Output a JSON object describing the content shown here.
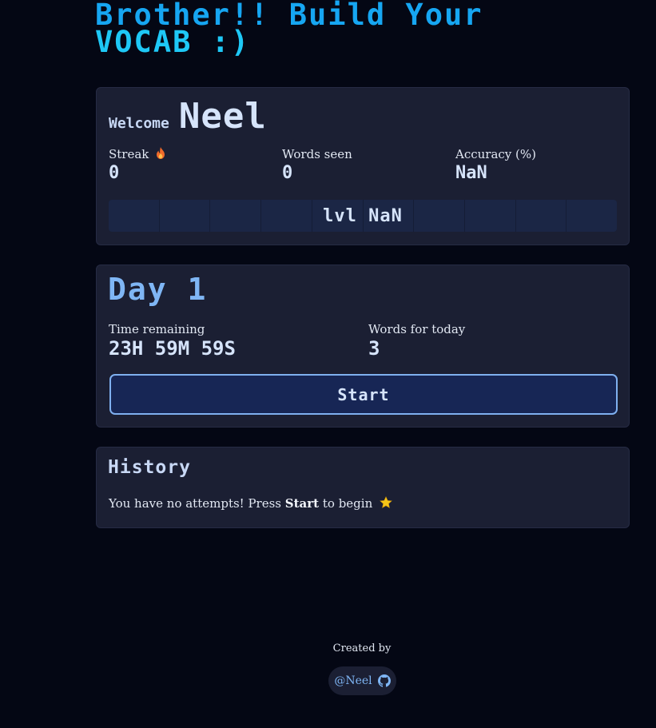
{
  "header": {
    "title_line1": "Brother!! Build Your",
    "title_line2": "VOCAB :)"
  },
  "welcome": {
    "label": "Welcome",
    "name": "Neel"
  },
  "stats": {
    "streak_label": "Streak",
    "streak_icon": "fire-icon",
    "streak_value": "0",
    "words_seen_label": "Words seen",
    "words_seen_value": "0",
    "accuracy_label": "Accuracy (%)",
    "accuracy_value": "NaN"
  },
  "level": {
    "text": "lvl NaN",
    "segments": 10,
    "fill_fraction": 0
  },
  "day": {
    "title": "Day 1",
    "time_label": "Time remaining",
    "time_value": "23H 59M 59S",
    "words_label": "Words for today",
    "words_value": "3",
    "start_label": "Start"
  },
  "history": {
    "title": "History",
    "msg_before": "You have no attempts! Press ",
    "msg_bold": "Start",
    "msg_after": " to begin",
    "msg_icon": "star-icon"
  },
  "footer": {
    "created_by": "Created by",
    "author": "@Neel",
    "author_icon": "github-icon"
  },
  "colors": {
    "background": "#040714",
    "card": "#1b1f33",
    "title_blue": "#16a6f2",
    "title_cyan": "#1ec8f6",
    "accent": "#7fb6f5",
    "button_bg": "#172655"
  }
}
